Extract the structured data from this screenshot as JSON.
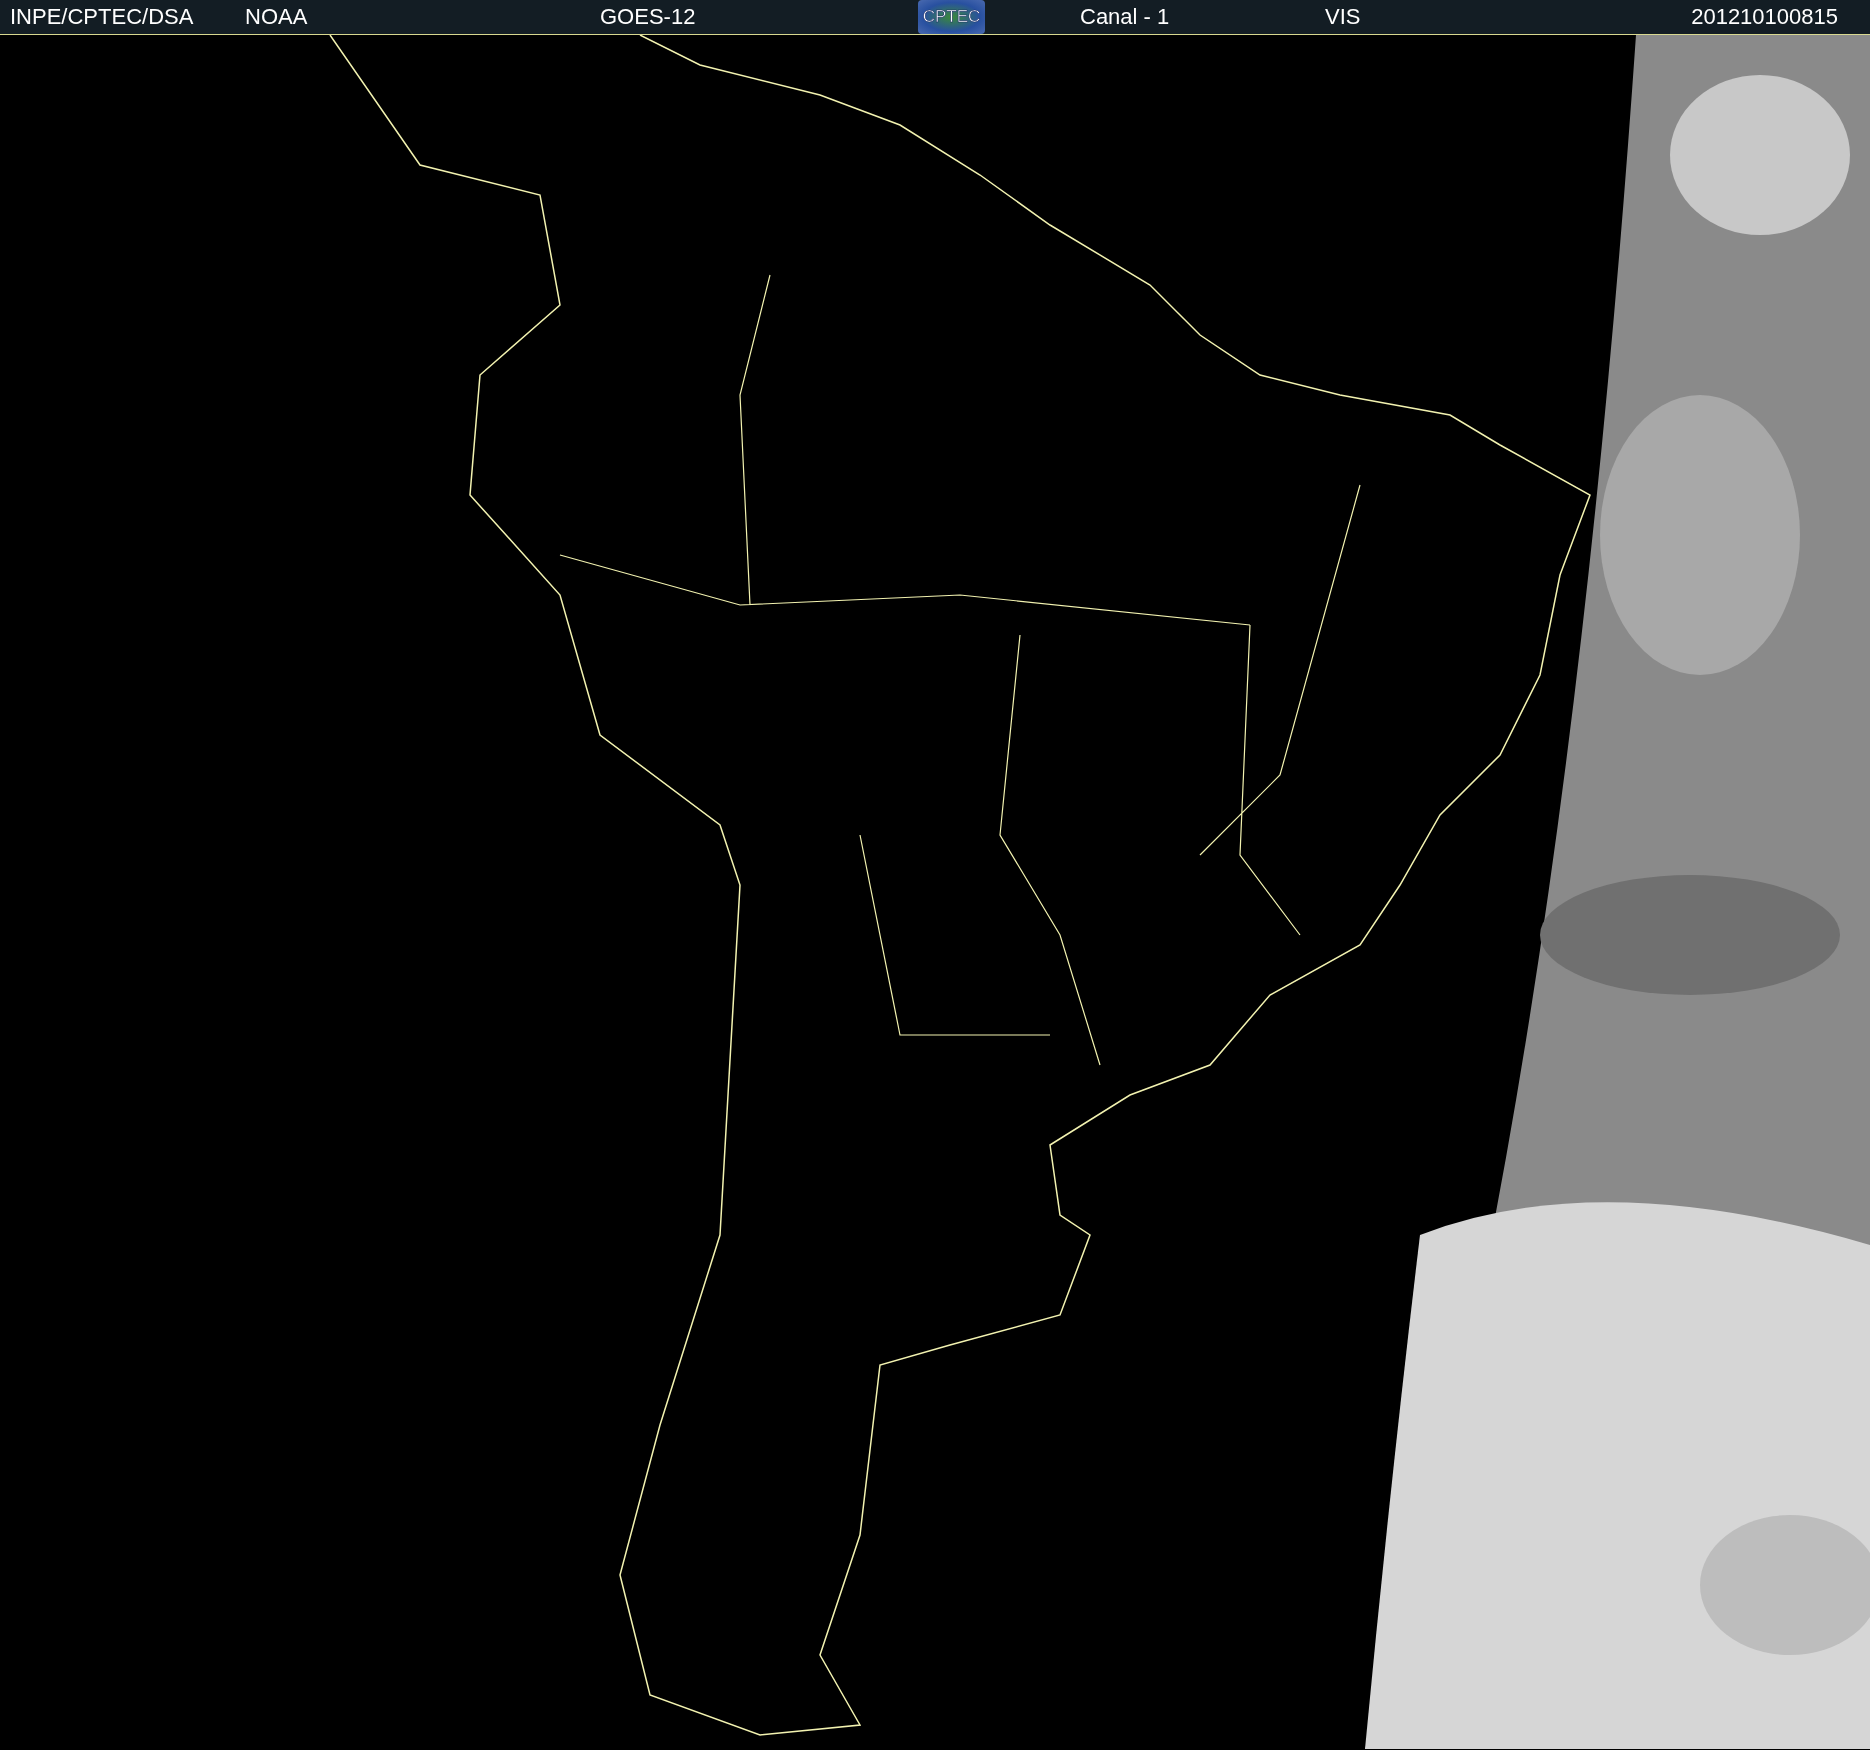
{
  "header": {
    "source": "INPE/CPTEC/DSA",
    "agency": "NOAA",
    "satellite": "GOES-12",
    "logo": "CPTEC",
    "channel": "Canal - 1",
    "band": "VIS",
    "timestamp": "201210100815"
  }
}
